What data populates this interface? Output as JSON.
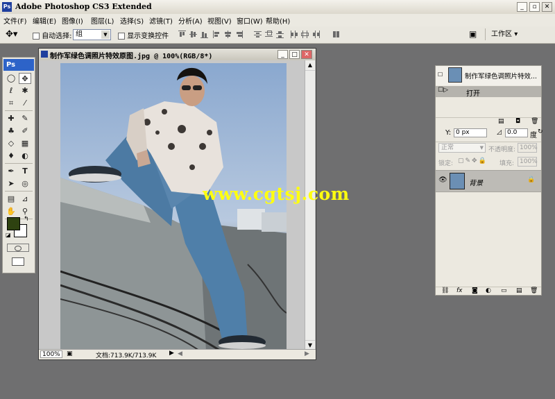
{
  "app": {
    "title": "Adobe Photoshop CS3 Extended",
    "logo": "Ps"
  },
  "menu": [
    "文件(F)",
    "编辑(E)",
    "图像(I)",
    "图层(L)",
    "选择(S)",
    "滤镜(T)",
    "分析(A)",
    "视图(V)",
    "窗口(W)",
    "帮助(H)"
  ],
  "options": {
    "auto_select_label": "自动选择:",
    "auto_select_value": "组",
    "show_transform_label": "显示变换控件",
    "workspace_label": "工作区"
  },
  "toolbox": {
    "header": "Ps",
    "foreground_color": "#2e4210",
    "background_color": "#ffffff"
  },
  "document": {
    "title": "制作军绿色调照片特效原图.jpg @ 100%(RGB/8*)",
    "zoom": "100%",
    "doc_size": "文档:713.9K/713.9K"
  },
  "watermark": "www.cgtsj.com",
  "history_panel": {
    "snapshot_label": "制作军绿色调照片特效...",
    "items": [
      "打开"
    ]
  },
  "transform_row": {
    "y_label": "Y:",
    "y_value": "0 px",
    "angle_value": "0.0",
    "angle_unit": "度"
  },
  "layers_panel": {
    "blend_mode": "正常",
    "opacity_label": "不透明度:",
    "opacity_value": "100%",
    "lock_label": "锁定:",
    "fill_label": "填充:",
    "fill_value": "100%",
    "layers": [
      {
        "name": "背景",
        "visible": true,
        "locked": true
      }
    ]
  }
}
